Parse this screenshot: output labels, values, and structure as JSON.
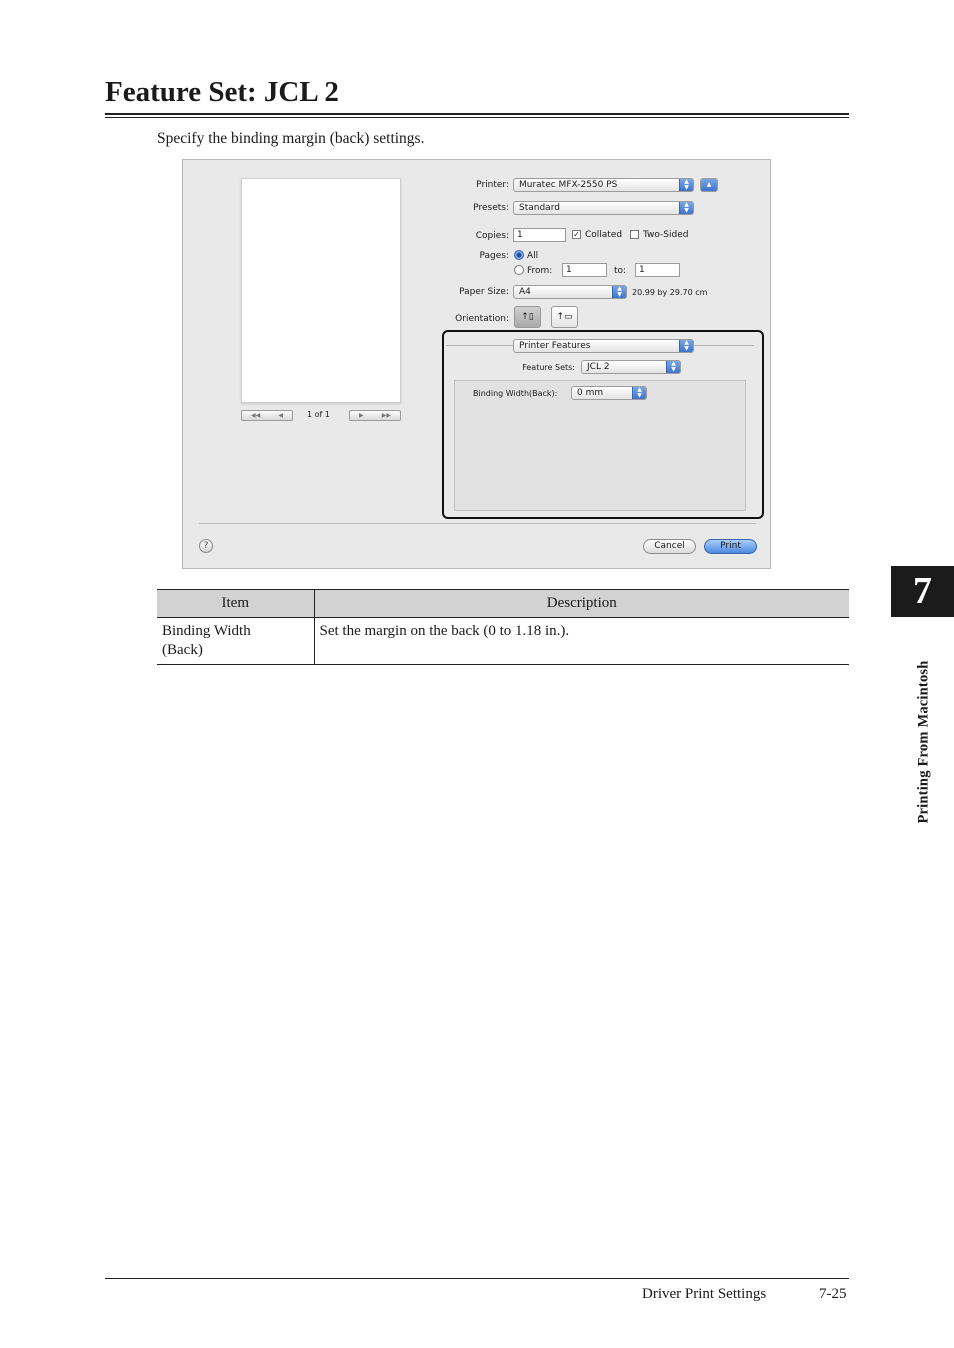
{
  "page": {
    "title": "Feature Set: JCL 2",
    "intro": "Specify the binding margin (back) settings.",
    "chapter_number": "7",
    "side_label": "Printing From Macintosh",
    "footer_section": "Driver Print Settings",
    "footer_page": "7-25"
  },
  "dialog": {
    "page_indicator": "1 of 1",
    "printer_label": "Printer:",
    "printer_value": "Muratec MFX-2550 PS",
    "presets_label": "Presets:",
    "presets_value": "Standard",
    "copies_label": "Copies:",
    "copies_value": "1",
    "collated_label": "Collated",
    "collated_checked": true,
    "two_sided_label": "Two-Sided",
    "two_sided_checked": false,
    "pages_label": "Pages:",
    "all_label": "All",
    "from_label": "From:",
    "from_value": "1",
    "to_label": "to:",
    "to_value": "1",
    "paper_size_label": "Paper Size:",
    "paper_size_value": "A4",
    "paper_dimensions": "20.99 by 29.70 cm",
    "orientation_label": "Orientation:",
    "panel_value": "Printer Features",
    "feature_sets_label": "Feature Sets:",
    "feature_sets_value": "JCL 2",
    "binding_width_label": "Binding Width(Back):",
    "binding_width_value": "0 mm",
    "help_glyph": "?",
    "cancel_label": "Cancel",
    "print_label": "Print"
  },
  "table": {
    "headers": [
      "Item",
      "Description"
    ],
    "rows": [
      {
        "item_line1": "Binding Width",
        "item_line2": "(Back)",
        "description": "Set the margin on the back (0 to 1.18 in.)."
      }
    ]
  },
  "colors": {
    "header_fill": "#d2d2d2",
    "tab_fill": "#1b1b1b",
    "accent_blue": "#4d8ae0"
  }
}
